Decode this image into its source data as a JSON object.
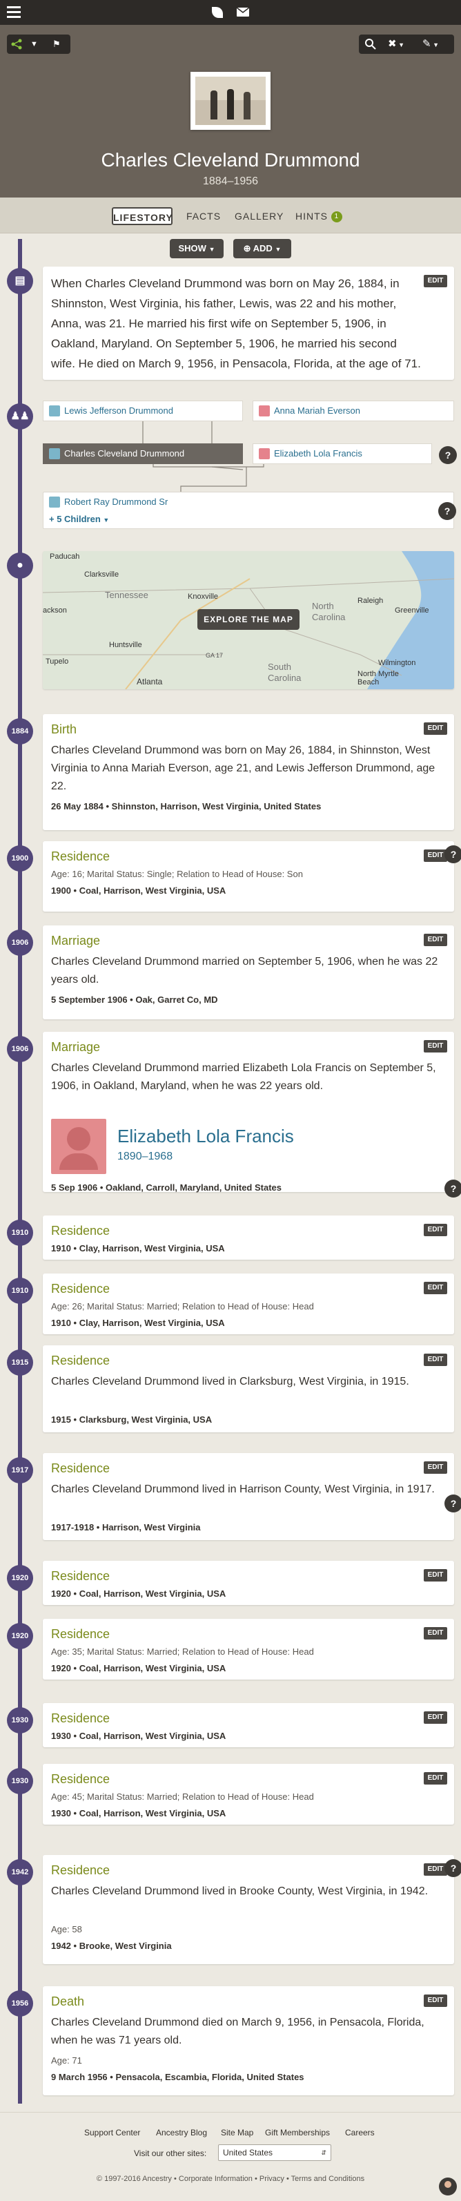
{
  "topbar": {
    "icons": [
      "menu-icon",
      "leaf-icon",
      "mail-icon",
      "avatar-icon"
    ]
  },
  "toolbar": {
    "search_icon": "search-icon",
    "tools_icon": "tools-icon",
    "edit_icon": "pencil-icon"
  },
  "person": {
    "name": "Charles Cleveland Drummond",
    "years": "1884–1956"
  },
  "tabs": [
    {
      "label": "LIFESTORY"
    },
    {
      "label": "FACTS"
    },
    {
      "label": "GALLERY"
    },
    {
      "label": "HINTS",
      "badge": "1"
    }
  ],
  "actions": {
    "show": "SHOW",
    "add": "ADD"
  },
  "summary": {
    "text": "When Charles Cleveland Drummond was born on May 26, 1884, in Shinnston, West Virginia, his father, Lewis, was 22 and his mother, Anna, was 21. He married his first wife on September 5, 1906, in Oakland, Maryland. On September 5, 1906, he married his second wife. He died on March 9, 1956, in Pensacola, Florida, at the age of 71.",
    "edit": "EDIT"
  },
  "family": {
    "father": "Lewis Jefferson Drummond",
    "mother": "Anna Mariah Everson",
    "self": "Charles Cleveland Drummond",
    "spouse": "Elizabeth Lola Francis",
    "child": "Robert Ray Drummond Sr",
    "more_children": "+ 5 Children"
  },
  "map": {
    "button": "EXPLORE THE MAP",
    "labels": [
      "Paducah",
      "Clarksville",
      "Tennessee",
      "Knoxville",
      "Raleigh",
      "Greenville",
      "North",
      "Carolina",
      "ackson",
      "Huntsville",
      "Tupelo",
      "Atlanta",
      "GA 17",
      "South",
      "Carolina",
      "Wilmington",
      "North Myrtle",
      "Beach"
    ]
  },
  "events": [
    {
      "year": "1884",
      "title": "Birth",
      "text": "Charles Cleveland Drummond was born on May 26, 1884, in Shinnston, West Virginia to Anna Mariah Everson, age 21, and Lewis Jefferson Drummond, age 22.",
      "meta": "",
      "place": "26 May 1884 • Shinnston, Harrison, West Virginia, United States"
    },
    {
      "year": "1900",
      "title": "Residence",
      "text": "",
      "meta": "Age: 16; Marital Status: Single; Relation to Head of House: Son",
      "place": "1900 • Coal, Harrison, West Virginia, USA"
    },
    {
      "year": "1906",
      "title": "Marriage",
      "text": "Charles Cleveland Drummond married on September 5, 1906, when he was 22 years old.",
      "meta": "",
      "place": "5 September 1906 • Oak, Garret Co, MD"
    },
    {
      "year": "1906",
      "title": "Marriage",
      "text": "Charles Cleveland Drummond married Elizabeth Lola Francis on September 5, 1906, in Oakland, Maryland, when he was 22 years old.",
      "meta": "",
      "place": "5 Sep 1906 • Oakland, Carroll, Maryland, United States",
      "spouse_name": "Elizabeth Lola Francis",
      "spouse_years": "1890–1968"
    },
    {
      "year": "1910",
      "title": "Residence",
      "text": "",
      "meta": "",
      "place": "1910 • Clay, Harrison, West Virginia, USA"
    },
    {
      "year": "1910",
      "title": "Residence",
      "text": "",
      "meta": "Age: 26; Marital Status: Married; Relation to Head of House: Head",
      "place": "1910 • Clay, Harrison, West Virginia, USA"
    },
    {
      "year": "1915",
      "title": "Residence",
      "text": "Charles Cleveland Drummond lived in Clarksburg, West Virginia, in 1915.",
      "meta": "",
      "place": "1915 • Clarksburg, West Virginia, USA"
    },
    {
      "year": "1917",
      "title": "Residence",
      "text": "Charles Cleveland Drummond lived in Harrison County, West Virginia, in 1917.",
      "meta": "",
      "place": "1917-1918 • Harrison, West Virginia"
    },
    {
      "year": "1920",
      "title": "Residence",
      "text": "",
      "meta": "",
      "place": "1920 • Coal, Harrison, West Virginia, USA"
    },
    {
      "year": "1920",
      "title": "Residence",
      "text": "",
      "meta": "Age: 35; Marital Status: Married; Relation to Head of House: Head",
      "place": "1920 • Coal, Harrison, West Virginia, USA"
    },
    {
      "year": "1930",
      "title": "Residence",
      "text": "",
      "meta": "",
      "place": "1930 • Coal, Harrison, West Virginia, USA"
    },
    {
      "year": "1930",
      "title": "Residence",
      "text": "",
      "meta": "Age: 45; Marital Status: Married; Relation to Head of House: Head",
      "place": "1930 • Coal, Harrison, West Virginia, USA"
    },
    {
      "year": "1942",
      "title": "Residence",
      "text": "Charles Cleveland Drummond lived in Brooke County, West Virginia, in 1942.",
      "meta": "Age: 58",
      "place": "1942 • Brooke, West Virginia"
    },
    {
      "year": "1956",
      "title": "Death",
      "text": "Charles Cleveland Drummond died on March 9, 1956, in Pensacola, Florida, when he was 71 years old.",
      "meta": "Age: 71",
      "place": "9 March 1956 • Pensacola, Escambia, Florida, United States"
    }
  ],
  "edit_label": "EDIT",
  "help_label": "?",
  "footer": {
    "links": [
      "Support Center",
      "Ancestry Blog",
      "Site Map",
      "Gift Memberships",
      "Careers"
    ],
    "other_sites_label": "Visit our other sites:",
    "select_value": "United States",
    "copyright": "© 1997-2016 Ancestry • Corporate Information • Privacy • Terms and Conditions"
  },
  "colors": {
    "timeline": "#524779",
    "event_title": "#7a8a1b",
    "link": "#2a6f8f",
    "hero": "#6a6259"
  }
}
